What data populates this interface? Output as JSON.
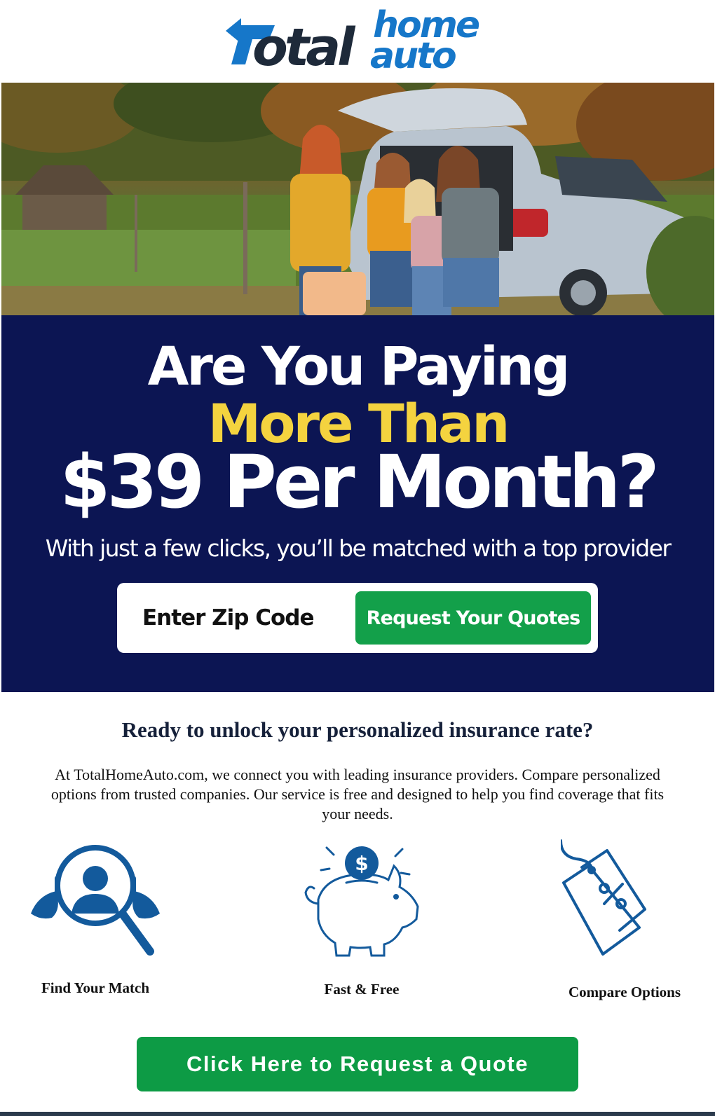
{
  "logo": {
    "word_main": "otal",
    "word_home": "home",
    "word_auto": "auto",
    "colors": {
      "dark": "#1e2a3a",
      "blue": "#1677c9"
    }
  },
  "hero": {
    "image_icon": "family-with-car-photo"
  },
  "banner": {
    "headline_line1": "Are You Paying",
    "headline_line2": "More Than",
    "headline_line3": "$39 Per Month?",
    "subheadline": "With just a few clicks, you’ll be matched with a top provider",
    "zip_placeholder": "Enter Zip Code",
    "zip_value": "",
    "quote_button_label": "Request Your Quotes",
    "colors": {
      "background": "#0c1553",
      "highlight": "#f4d33f",
      "button": "#13a04a"
    }
  },
  "content": {
    "title": "Ready to unlock your personalized insurance rate?",
    "intro": "At TotalHomeAuto.com, we connect you with leading insurance providers. Compare personalized options from trusted companies. Our service is free and designed to help you find coverage that fits your needs."
  },
  "features": [
    {
      "icon": "magnifier-person-icon",
      "label": "Find Your Match"
    },
    {
      "icon": "piggy-bank-icon",
      "label": "Fast & Free"
    },
    {
      "icon": "price-tag-percent-icon",
      "label": "Compare Options"
    }
  ],
  "cta": {
    "label": "Click Here to Request a Quote",
    "color": "#0d9b45"
  }
}
